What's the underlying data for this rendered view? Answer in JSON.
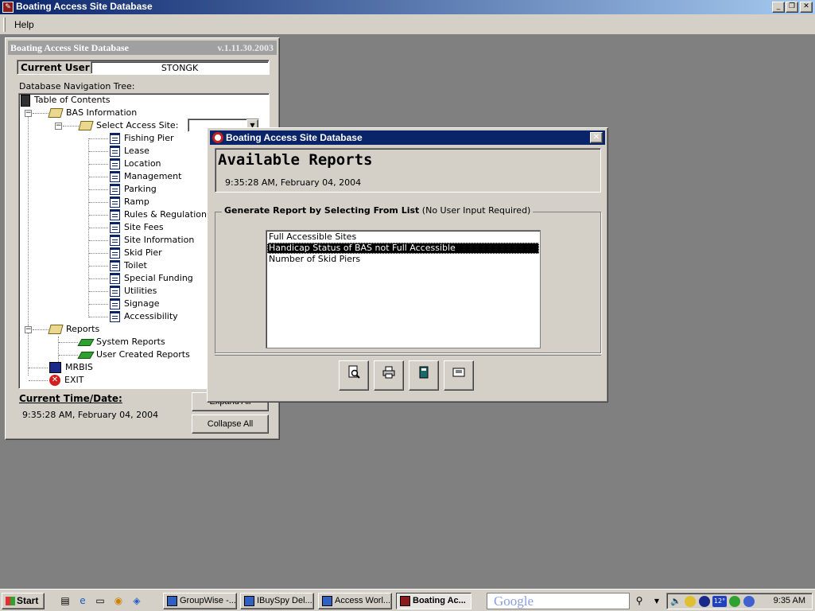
{
  "window": {
    "title": "Boating Access Site Database"
  },
  "menu": {
    "items": [
      "Help"
    ]
  },
  "nav_form": {
    "title": "Boating Access Site Database",
    "version": "v.1.11.30.2003",
    "current_user_label": "Current User",
    "current_user": "STONGK",
    "tree_label": "Database Navigation Tree:",
    "tree": {
      "root": "Table of Contents",
      "bas_information": "BAS Information",
      "select_access_site": "Select Access Site:",
      "bas_items": [
        "Fishing Pier",
        "Lease",
        "Location",
        "Management",
        "Parking",
        "Ramp",
        "Rules & Regulations",
        "Site Fees",
        "Site Information",
        "Skid Pier",
        "Toilet",
        "Special Funding",
        "Utilities",
        "Signage",
        "Accessibility"
      ],
      "reports": "Reports",
      "system_reports": "System Reports",
      "user_created_reports": "User Created Reports",
      "mrbis": "MRBIS",
      "exit": "EXIT"
    },
    "time_label": "Current Time/Date:",
    "time_value": "9:35:28 AM, February 04, 2004",
    "expand_all": "Expand All",
    "collapse_all": "Collapse All"
  },
  "dialog": {
    "title": "Boating Access Site Database",
    "heading": "Available Reports",
    "timestamp": "9:35:28 AM, February 04, 2004",
    "group_label_bold": "Generate Report by Selecting From List",
    "group_label_note": "(No User Input Required)",
    "reports": [
      "Full Accessible Sites",
      "Handicap Status of BAS not Full Accessible",
      "Number of Skid Piers"
    ],
    "selected_index": 1,
    "close_label": "✕"
  },
  "taskbar": {
    "start": "Start",
    "tasks": [
      "GroupWise -...",
      "IBuySpy Del...",
      "Access Worl...",
      "Boating Ac..."
    ],
    "active_task": 3,
    "search_logo": "Google",
    "tray_temp": "12°",
    "clock": "9:35 AM"
  },
  "colors": {
    "titlebar": "#0a246a",
    "desktop": "#808080",
    "face": "#d4d0c8",
    "selection": "#000000"
  }
}
